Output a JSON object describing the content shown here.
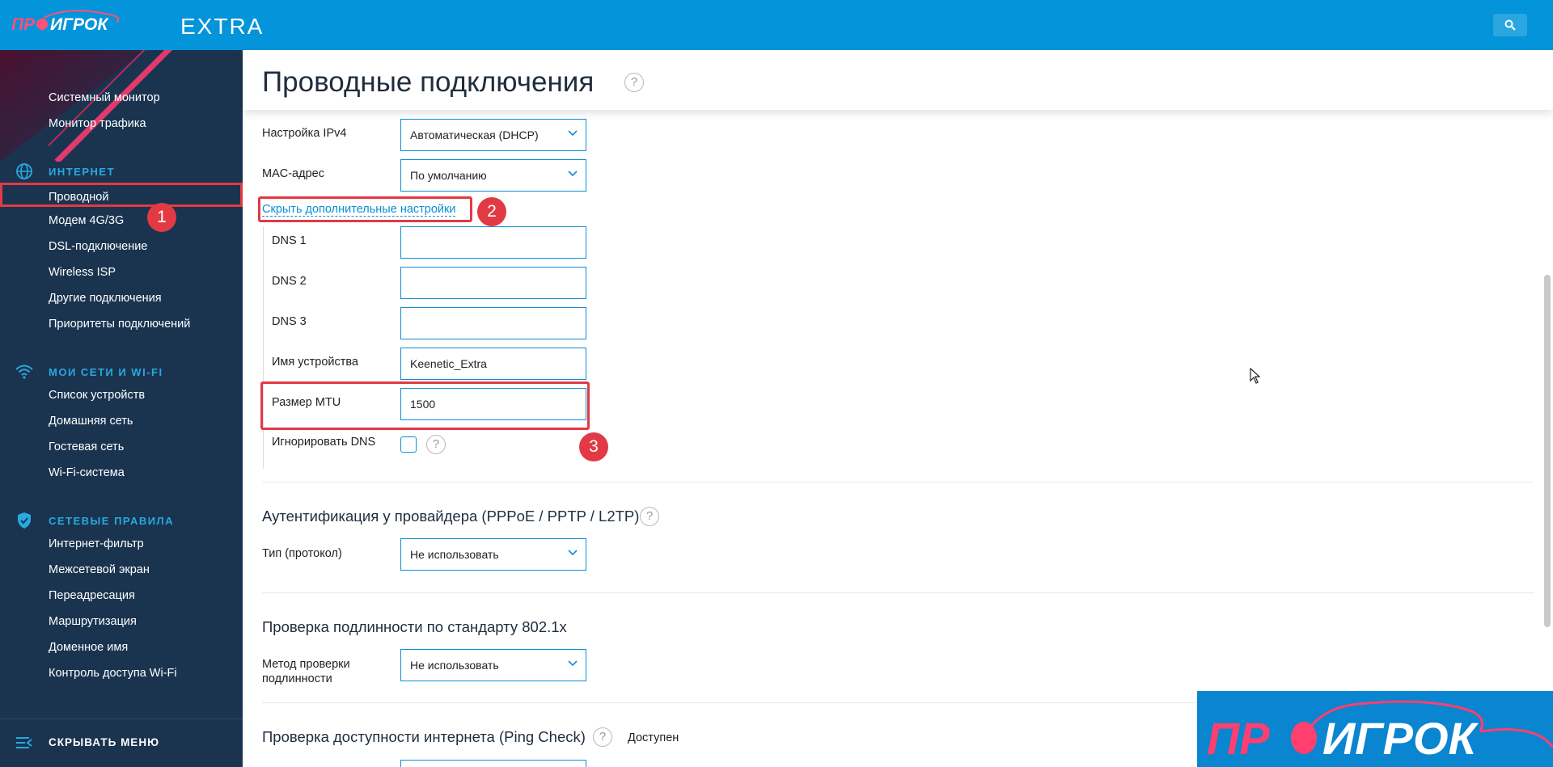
{
  "app": {
    "brand": "ПРОИГРОК",
    "edition": "EXTRA",
    "colors": {
      "topbar": "#0494d9",
      "sidebar": "#1a3450",
      "accent": "#28a9e0",
      "highlight": "#e23a44"
    }
  },
  "sidebar": {
    "top_items": [
      {
        "label": "Системный монитор",
        "icon": ""
      },
      {
        "label": "Монитор трафика",
        "icon": ""
      }
    ],
    "sections": [
      {
        "title": "ИНТЕРНЕТ",
        "icon": "globe-icon",
        "items": [
          "Проводной",
          "Модем 4G/3G",
          "DSL-подключение",
          "Wireless ISP",
          "Другие подключения",
          "Приоритеты подключений"
        ]
      },
      {
        "title": "МОИ СЕТИ И WI-FI",
        "icon": "wifi-icon",
        "items": [
          "Список устройств",
          "Домашняя сеть",
          "Гостевая сеть",
          "Wi-Fi-система"
        ]
      },
      {
        "title": "СЕТЕВЫЕ ПРАВИЛА",
        "icon": "shield-icon",
        "items": [
          "Интернет-фильтр",
          "Межсетевой экран",
          "Переадресация",
          "Маршрутизация",
          "Доменное имя",
          "Контроль доступа Wi-Fi"
        ]
      }
    ],
    "active_item": "Проводной",
    "collapse_label": "СКРЫВАТЬ МЕНЮ"
  },
  "page": {
    "title": "Проводные подключения",
    "ipv4_label": "Настройка IPv4",
    "ipv4_value": "Автоматическая (DHCP)",
    "mac_label": "MAC-адрес",
    "mac_value": "По умолчанию",
    "advanced_link": "Скрыть дополнительные настройки",
    "dns1_label": "DNS 1",
    "dns1_value": "",
    "dns2_label": "DNS 2",
    "dns2_value": "",
    "dns3_label": "DNS 3",
    "dns3_value": "",
    "device_name_label": "Имя устройства",
    "device_name_value": "Keenetic_Extra",
    "mtu_label": "Размер MTU",
    "mtu_value": "1500",
    "ignore_dns_label": "Игнорировать DNS",
    "ignore_dns_checked": false,
    "auth_title": "Аутентификация у провайдера (PPPoE / PPTP / L2TP)",
    "protocol_label": "Тип (протокол)",
    "protocol_value": "Не использовать",
    "dot1x_title": "Проверка подлинности по стандарту 802.1x",
    "dot1x_method_label": "Метод проверки подлинности",
    "dot1x_method_value": "Не использовать",
    "ping_title": "Проверка доступности интернета (Ping Check)",
    "ping_status": "Доступен"
  },
  "annotations": [
    "1",
    "2",
    "3"
  ]
}
